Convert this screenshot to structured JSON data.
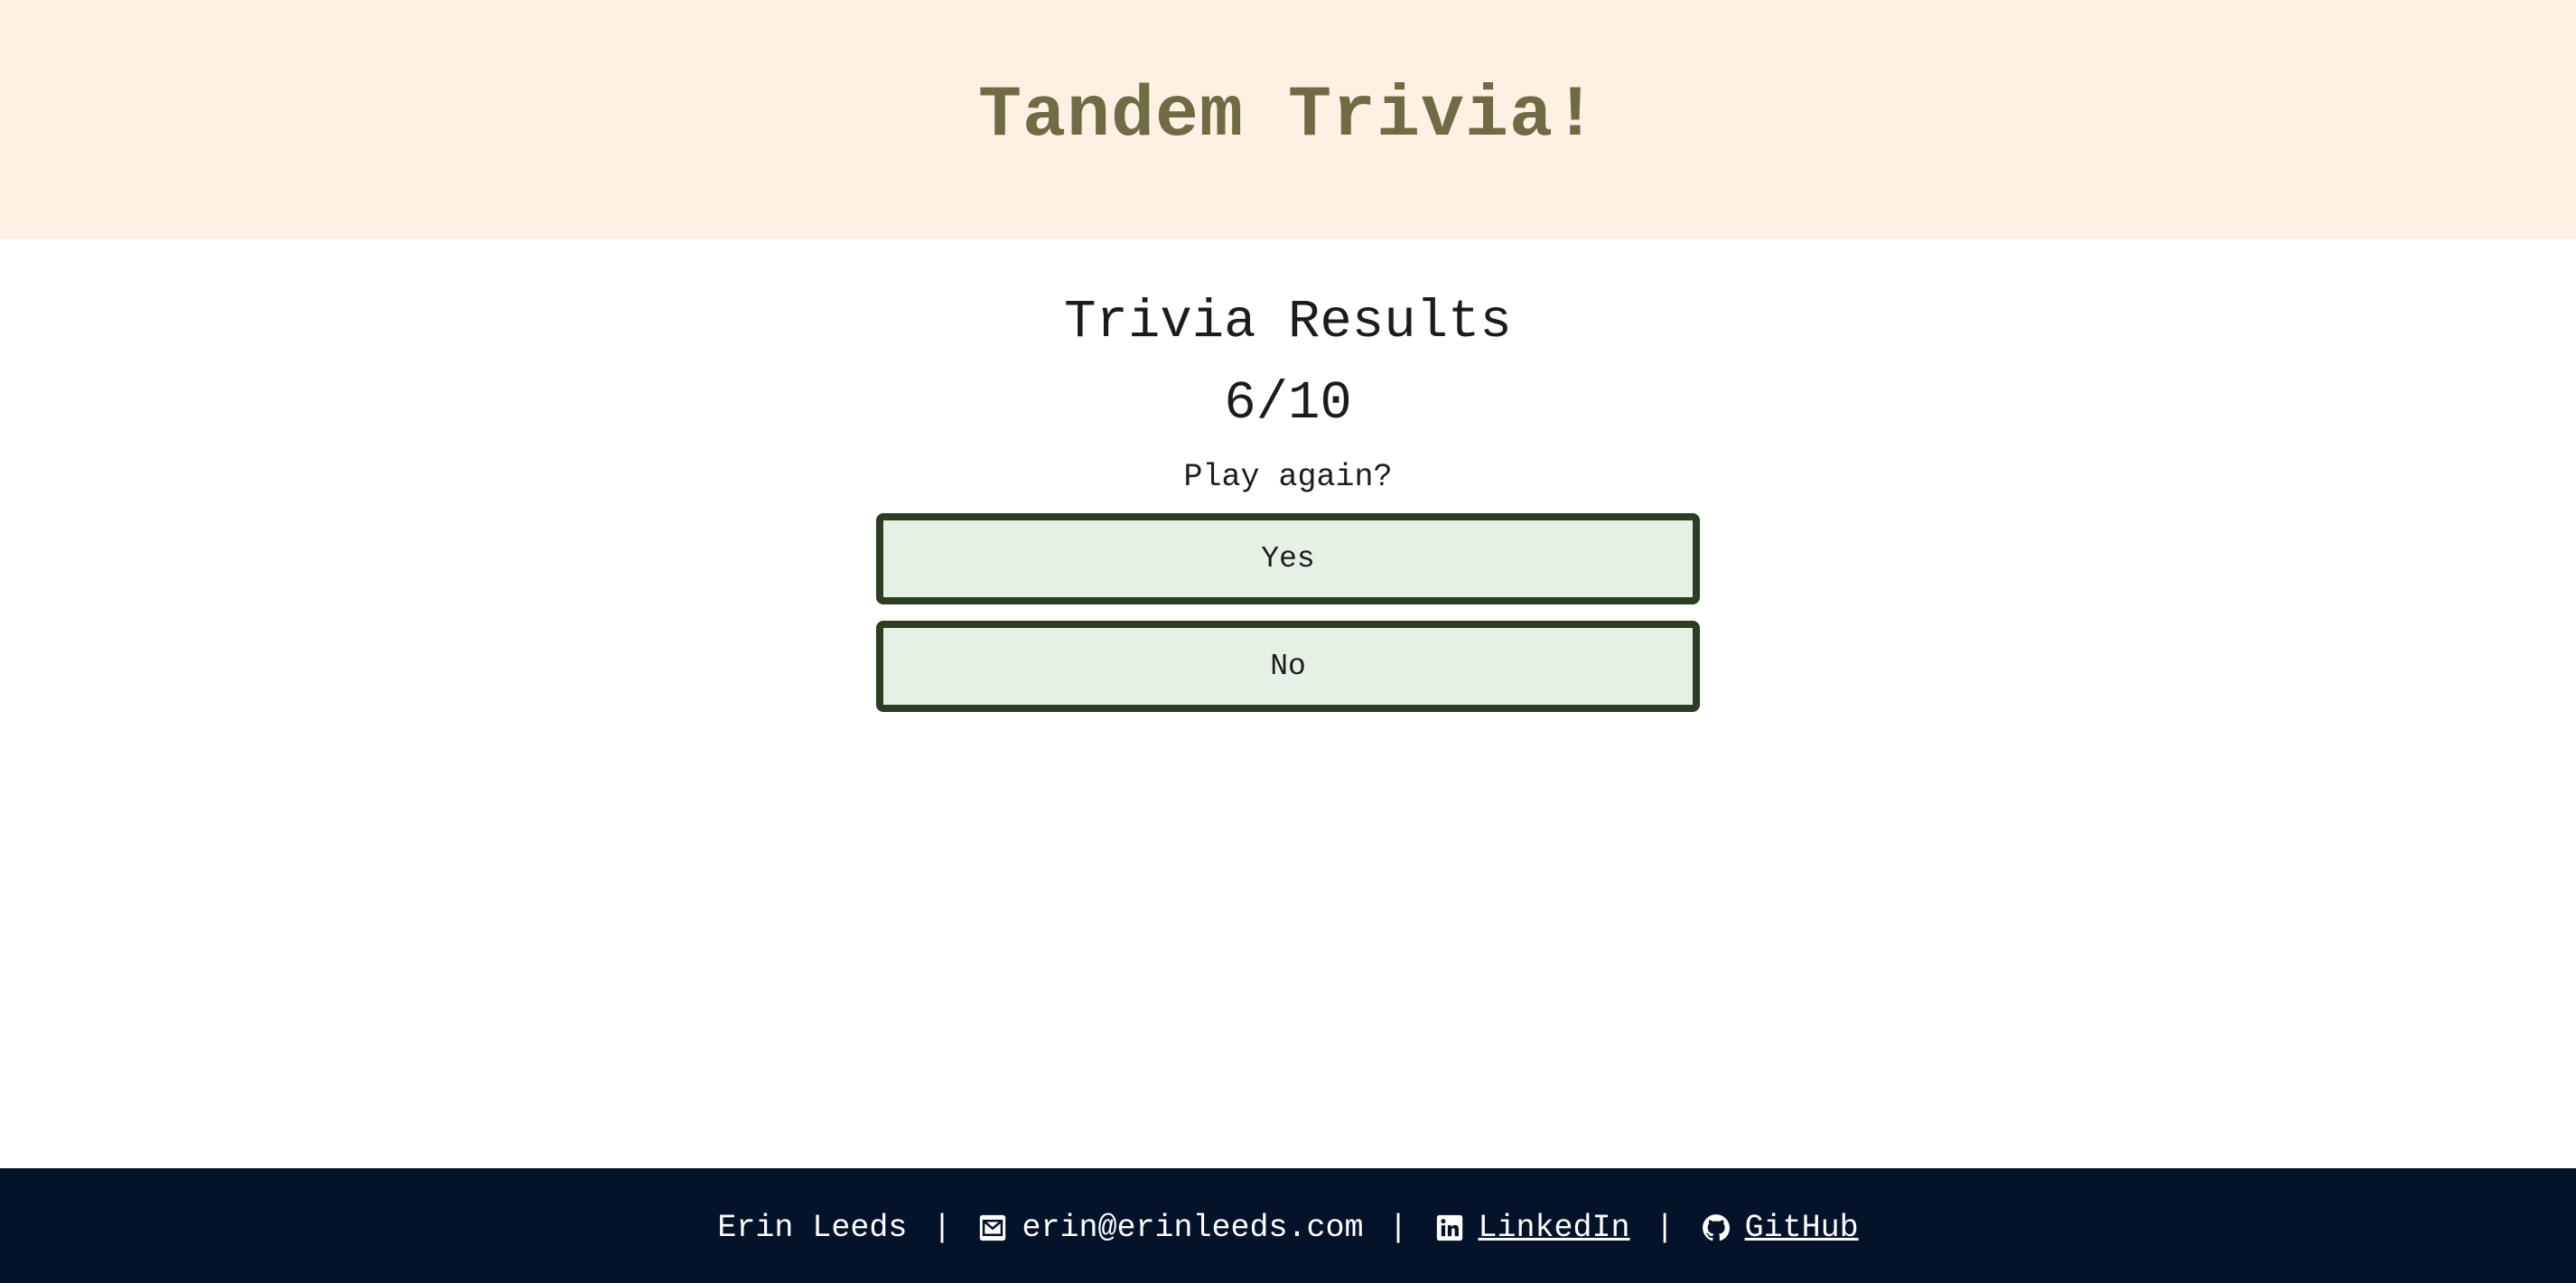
{
  "header": {
    "title": "Tandem Trivia!"
  },
  "results": {
    "title": "Trivia Results",
    "score": "6/10",
    "prompt": "Play again?",
    "yes_label": "Yes",
    "no_label": "No"
  },
  "footer": {
    "name": "Erin Leeds",
    "separator": "|",
    "email": "erin@erinleeds.com",
    "linkedin_label": "LinkedIn",
    "github_label": "GitHub",
    "icons": {
      "email": "envelope-icon",
      "linkedin": "linkedin-icon",
      "github": "github-icon"
    }
  },
  "colors": {
    "header_bg": "#fdf1e3",
    "title_color": "#6f6b45",
    "button_bg": "#e5f1e4",
    "button_border": "#2b3d22",
    "footer_bg": "#04132a"
  }
}
